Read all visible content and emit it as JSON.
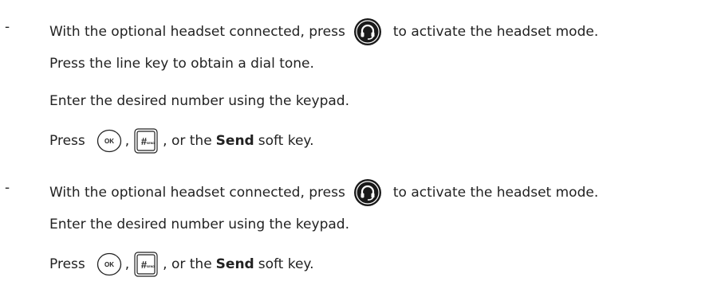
{
  "blocks": [
    {
      "bullet": "-",
      "steps": [
        {
          "type": "headset",
          "before": "With the optional headset connected, press",
          "after": "to activate the headset mode."
        },
        {
          "type": "text",
          "text": "Press the line key to obtain a dial tone."
        },
        {
          "type": "text",
          "text": "Enter the desired number using the keypad."
        },
        {
          "type": "send",
          "press": "Press",
          "comma": ",",
          "or_the": ", or the",
          "bold": "Send",
          "tail": "soft key."
        }
      ]
    },
    {
      "bullet": "-",
      "steps": [
        {
          "type": "headset",
          "before": "With the optional headset connected, press",
          "after": "to activate the headset mode."
        },
        {
          "type": "text",
          "text": "Enter the desired number using the keypad."
        },
        {
          "type": "send",
          "press": "Press",
          "comma": ",",
          "or_the": ", or the",
          "bold": "Send",
          "tail": "soft key."
        }
      ]
    }
  ],
  "icons": {
    "headset_key": "headset-icon",
    "ok_key": "ok-key-icon",
    "ok_label": "OK",
    "send_key": "send-key-icon",
    "send_hash": "#",
    "send_label": "SEND"
  }
}
